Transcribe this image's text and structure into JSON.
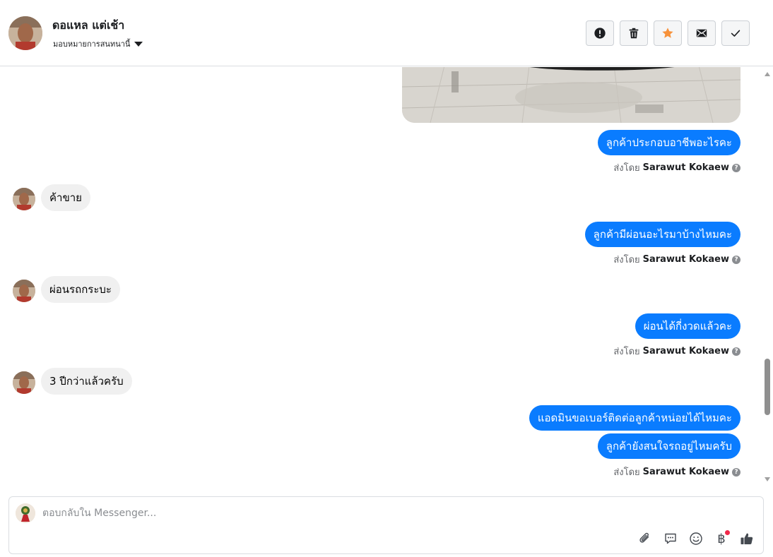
{
  "header": {
    "contact_name": "ดอแหล แต่เช้า",
    "assign_label": "มอบหมายการสนทนานี้",
    "actions": [
      {
        "name": "spam-button",
        "icon": "alert-circle-icon"
      },
      {
        "name": "delete-button",
        "icon": "trash-icon"
      },
      {
        "name": "star-button",
        "icon": "star-icon",
        "color": "#f7923b"
      },
      {
        "name": "mark-unread-button",
        "icon": "envelope-icon"
      },
      {
        "name": "mark-done-button",
        "icon": "checkmark-icon"
      }
    ]
  },
  "messages": [
    {
      "direction": "out",
      "text": "ลูกค้าประกอบอาชีพอะไรคะ"
    },
    {
      "direction": "in",
      "text": "ค้าขาย"
    },
    {
      "direction": "out",
      "text": "ลูกค้ามีผ่อนอะไรมาบ้างไหมคะ"
    },
    {
      "direction": "in",
      "text": "ผ่อนรถกระบะ"
    },
    {
      "direction": "out",
      "text": "ผ่อนได้กี่งวดแล้วคะ"
    },
    {
      "direction": "in",
      "text": "3 ปีกว่าแล้วครับ"
    },
    {
      "direction": "out",
      "text": "แอดมินขอเบอร์ติดต่อลูกค้าหน่อยได้ไหมคะ"
    },
    {
      "direction": "out",
      "text": "ลูกค้ายังสนใจรถอยู่ไหมครับ"
    }
  ],
  "sent_by": {
    "prefix": "ส่งโดย",
    "sender": "Sarawut Kokaew"
  },
  "composer": {
    "placeholder": "ตอบกลับใน Messenger...",
    "tools": [
      "paperclip-icon",
      "saved-reply-icon",
      "emoji-icon",
      "baht-payment-icon",
      "thumbs-up-icon"
    ],
    "baht_symbol": "฿"
  },
  "colors": {
    "outgoing_bubble": "#0a7cff",
    "incoming_bubble": "#f0f0f0",
    "star": "#f7923b"
  }
}
